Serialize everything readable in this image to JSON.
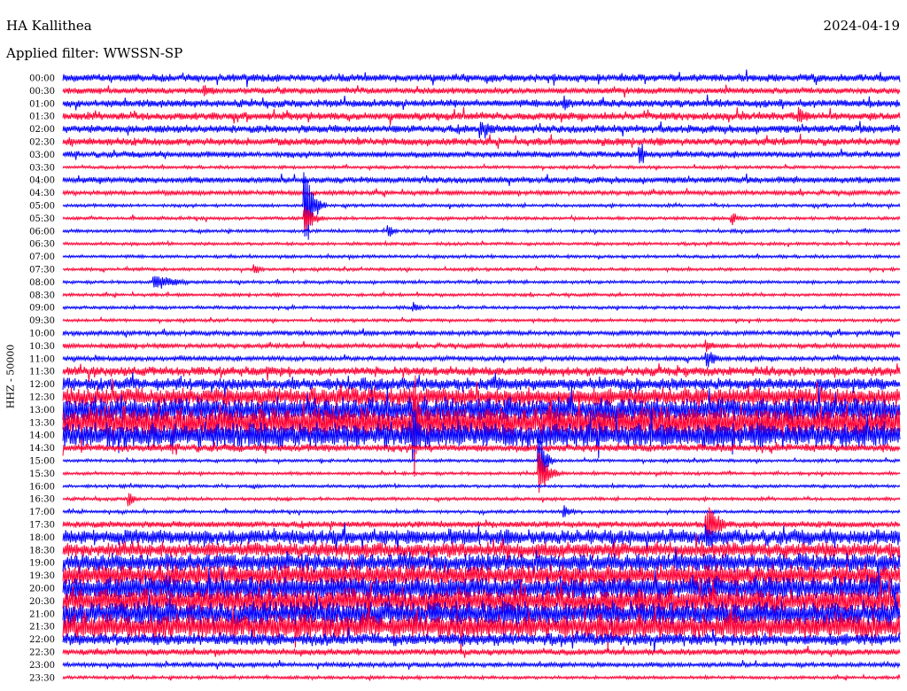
{
  "header": {
    "station": "HA Kallithea",
    "date": "2024-04-19",
    "filter": "Applied filter: WWSSN-SP"
  },
  "chart_data": {
    "type": "line",
    "title": "HA Kallithea",
    "subtitle": "Applied filter: WWSSN-SP",
    "ylabel": "HHZ - 50000",
    "series_colors": [
      "#0000ff",
      "#ff0033"
    ],
    "row_labels": [
      "00:00",
      "00:30",
      "01:00",
      "01:30",
      "02:00",
      "02:30",
      "03:00",
      "03:30",
      "04:00",
      "04:30",
      "05:00",
      "05:30",
      "06:00",
      "06:30",
      "07:00",
      "07:30",
      "08:00",
      "08:30",
      "09:00",
      "09:30",
      "10:00",
      "10:30",
      "11:00",
      "11:30",
      "12:00",
      "12:30",
      "13:00",
      "13:30",
      "14:00",
      "14:30",
      "15:00",
      "15:30",
      "16:00",
      "16:30",
      "17:00",
      "17:30",
      "18:00",
      "18:30",
      "19:00",
      "19:30",
      "20:00",
      "20:30",
      "21:00",
      "21:30",
      "22:00",
      "22:30",
      "23:00",
      "23:30"
    ],
    "noise_level": [
      5,
      4,
      5,
      5,
      5,
      5,
      4,
      2,
      4,
      3,
      2,
      2,
      2,
      2,
      2,
      2,
      2,
      2,
      2,
      2,
      3,
      3,
      3,
      6,
      8,
      12,
      16,
      20,
      16,
      5,
      2,
      2,
      2,
      2,
      2,
      4,
      10,
      10,
      12,
      14,
      16,
      16,
      16,
      16,
      8,
      4,
      3,
      2
    ],
    "events": [
      {
        "row": 1,
        "x": 0.17,
        "amp": 10,
        "dur": 0.04
      },
      {
        "row": 2,
        "x": 0.6,
        "amp": 10,
        "dur": 0.03
      },
      {
        "row": 3,
        "x": 0.88,
        "amp": 12,
        "dur": 0.05
      },
      {
        "row": 4,
        "x": 0.5,
        "amp": 12,
        "dur": 0.05
      },
      {
        "row": 6,
        "x": 0.69,
        "amp": 18,
        "dur": 0.02
      },
      {
        "row": 10,
        "x": 0.29,
        "amp": 60,
        "dur": 0.025
      },
      {
        "row": 11,
        "x": 0.29,
        "amp": 20,
        "dur": 0.03
      },
      {
        "row": 11,
        "x": 0.8,
        "amp": 10,
        "dur": 0.02
      },
      {
        "row": 12,
        "x": 0.39,
        "amp": 12,
        "dur": 0.015
      },
      {
        "row": 15,
        "x": 0.23,
        "amp": 8,
        "dur": 0.02
      },
      {
        "row": 16,
        "x": 0.11,
        "amp": 12,
        "dur": 0.07
      },
      {
        "row": 18,
        "x": 0.42,
        "amp": 8,
        "dur": 0.02
      },
      {
        "row": 21,
        "x": 0.77,
        "amp": 10,
        "dur": 0.02
      },
      {
        "row": 22,
        "x": 0.77,
        "amp": 14,
        "dur": 0.03
      },
      {
        "row": 27,
        "x": 0.42,
        "amp": 80,
        "dur": 0.015
      },
      {
        "row": 28,
        "x": 0.42,
        "amp": 40,
        "dur": 0.02
      },
      {
        "row": 30,
        "x": 0.57,
        "amp": 40,
        "dur": 0.02
      },
      {
        "row": 31,
        "x": 0.57,
        "amp": 30,
        "dur": 0.03
      },
      {
        "row": 33,
        "x": 0.08,
        "amp": 10,
        "dur": 0.02
      },
      {
        "row": 34,
        "x": 0.6,
        "amp": 10,
        "dur": 0.02
      },
      {
        "row": 35,
        "x": 0.77,
        "amp": 30,
        "dur": 0.04
      },
      {
        "row": 36,
        "x": 0.77,
        "amp": 18,
        "dur": 0.05
      }
    ]
  }
}
